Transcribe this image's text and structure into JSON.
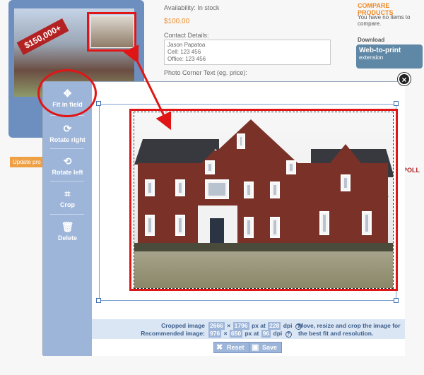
{
  "background": {
    "price_badge": "$150,000+",
    "availability": "Availability: In stock",
    "price": "$100.00",
    "contact_label": "Contact Details:",
    "contact_lines": [
      "Jason Papatoa",
      "Cell: 123 456",
      "Office: 123 456"
    ],
    "photo_text_label": "Photo Corner Text (eg. price):",
    "compare_title": "COMPARE PRODUCTS",
    "compare_note": "You have no items to compare.",
    "download_label": "Download",
    "w2p_title": "Web-to-print",
    "w2p_sub": "extension",
    "poll_label": "POLL",
    "update_button": "Update pro"
  },
  "toolbar": {
    "fit_label": "Fit in field",
    "rotate_right_label": "Rotate right",
    "rotate_left_label": "Rotate left",
    "crop_label": "Crop",
    "delete_label": "Delete"
  },
  "info": {
    "cropped_label": "Cropped image",
    "recommended_label": "Recommended image:",
    "cropped_w": "2666",
    "cropped_h": "1796",
    "cropped_dpi": "228",
    "recommended_w": "976",
    "recommended_h": "650",
    "recommended_dpi": "96",
    "x_sep": "×",
    "px_at": "px at",
    "dpi": "dpi",
    "message": "Move, resize and crop the image for the best fit and resolution."
  },
  "actions": {
    "reset_label": "Reset",
    "save_label": "Save"
  },
  "colors": {
    "accent": "#9db5d9",
    "highlight": "#e01616",
    "orange": "#f08a24"
  }
}
